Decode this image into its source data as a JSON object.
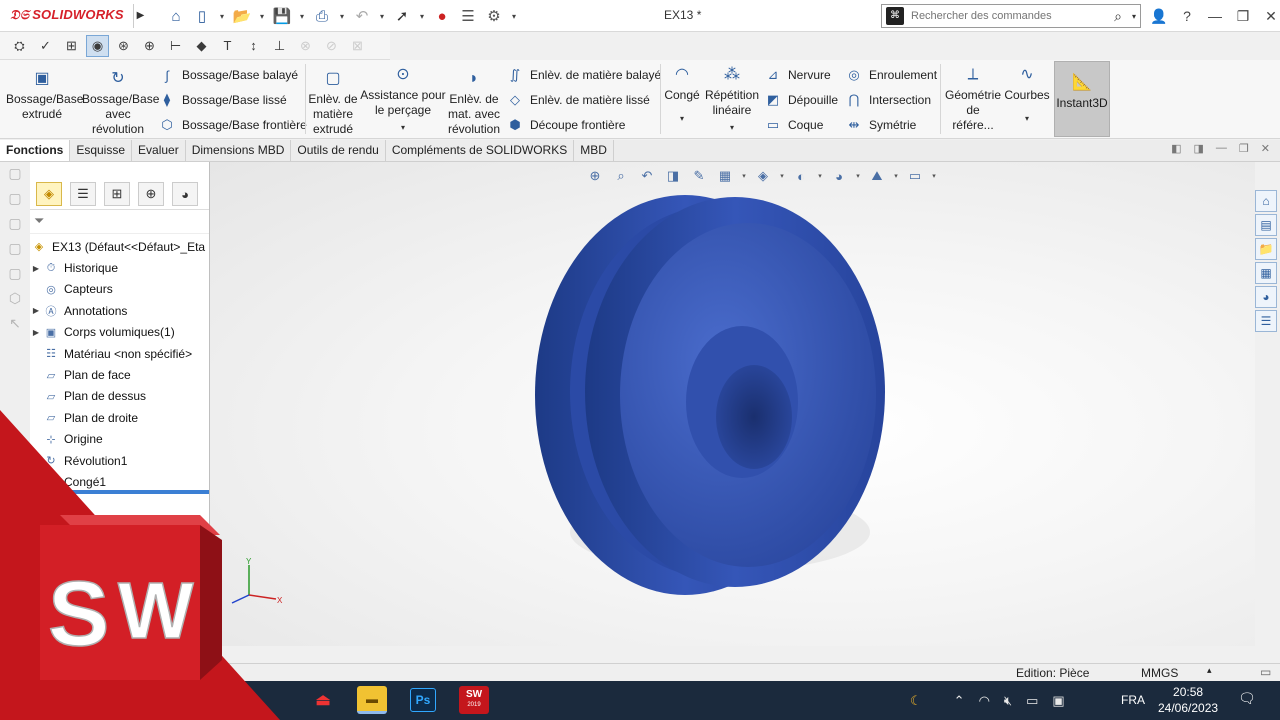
{
  "app": {
    "logo_text": "SOLIDWORKS",
    "document_title": "EX13 *"
  },
  "search": {
    "placeholder": "Rechercher des commandes"
  },
  "ribbon": {
    "big_buttons": {
      "bossage_extrude": [
        "Bossage/Base",
        "extrudé"
      ],
      "bossage_revolution": [
        "Bossage/Base",
        "avec",
        "révolution"
      ],
      "enlev_extrude": [
        "Enlèv. de",
        "matière",
        "extrudé"
      ],
      "assistance_percage": [
        "Assistance pour",
        "le perçage"
      ],
      "enlev_revolution": [
        "Enlèv. de",
        "mat. avec",
        "révolution"
      ],
      "conge": "Congé",
      "repetition": [
        "Répétition",
        "linéaire"
      ],
      "geometrie": [
        "Géométrie",
        "de référe..."
      ],
      "courbes": "Courbes",
      "instant3d": "Instant3D"
    },
    "small_buttons": {
      "bossage_balaye": "Bossage/Base balayé",
      "bossage_lisse": "Bossage/Base lissé",
      "bossage_frontiere": "Bossage/Base frontière",
      "enlev_balaye": "Enlèv. de matière balayé",
      "enlev_lisse": "Enlèv. de matière lissé",
      "decoupe_frontiere": "Découpe frontière",
      "nervure": "Nervure",
      "depouille": "Dépouille",
      "coque": "Coque",
      "enroulement": "Enroulement",
      "intersection": "Intersection",
      "symetrie": "Symétrie"
    }
  },
  "tabs": [
    "Fonctions",
    "Esquisse",
    "Evaluer",
    "Dimensions MBD",
    "Outils de rendu",
    "Compléments de SOLIDWORKS",
    "MBD"
  ],
  "feature_tree": {
    "root": "EX13  (Défaut<<Défaut>_Eta",
    "items": [
      {
        "label": "Historique",
        "icon": "history-icon",
        "expandable": true
      },
      {
        "label": "Capteurs",
        "icon": "sensor-icon",
        "expandable": false
      },
      {
        "label": "Annotations",
        "icon": "annotation-icon",
        "expandable": true
      },
      {
        "label": "Corps volumiques(1)",
        "icon": "solid-body-icon",
        "expandable": true
      },
      {
        "label": "Matériau <non spécifié>",
        "icon": "material-icon",
        "expandable": false
      },
      {
        "label": "Plan de face",
        "icon": "plane-icon",
        "expandable": false
      },
      {
        "label": "Plan de dessus",
        "icon": "plane-icon",
        "expandable": false
      },
      {
        "label": "Plan de droite",
        "icon": "plane-icon",
        "expandable": false
      },
      {
        "label": "Origine",
        "icon": "origin-icon",
        "expandable": false
      },
      {
        "label": "Révolution1",
        "icon": "revolve-icon",
        "expandable": true
      },
      {
        "label": "Congé1",
        "icon": "fillet-icon",
        "expandable": false
      }
    ]
  },
  "status": {
    "mode": "Edition: Pièce",
    "units": "MMGS"
  },
  "taskbar": {
    "lang": "FRA",
    "time": "20:58",
    "date": "24/06/2023",
    "sw_year": "2019"
  },
  "overlay": {
    "letters": [
      "S",
      "W"
    ]
  },
  "colors": {
    "accent": "#3b7fd4",
    "brand_red": "#c4161c",
    "part_blue": "#2d4fa8",
    "taskbar": "#1b2a3d"
  }
}
